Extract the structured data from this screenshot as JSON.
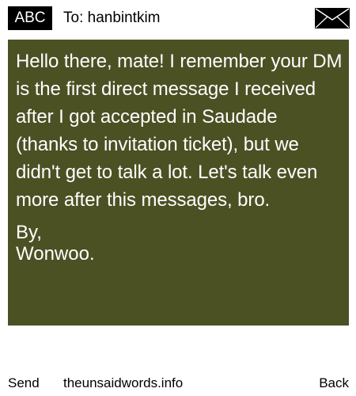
{
  "header": {
    "badge": "ABC",
    "recipient_line": "To: hanbintkim",
    "mail_icon": "envelope-icon"
  },
  "message": {
    "body": "Hello there, mate! I remember your DM is the first direct message I received after I got accepted in Saudade (thanks to invitation ticket), but we didn't get to talk a lot. Let's talk even more after this messages, bro.",
    "signoff_label": "By,",
    "signature": "Wonwoo."
  },
  "footer": {
    "send_label": "Send",
    "site": "theunsaidwords.info",
    "back_label": "Back"
  },
  "colors": {
    "message_background": "#4b5123",
    "message_text": "#ffffff",
    "page_background": "#ffffff",
    "badge_background": "#000000"
  }
}
